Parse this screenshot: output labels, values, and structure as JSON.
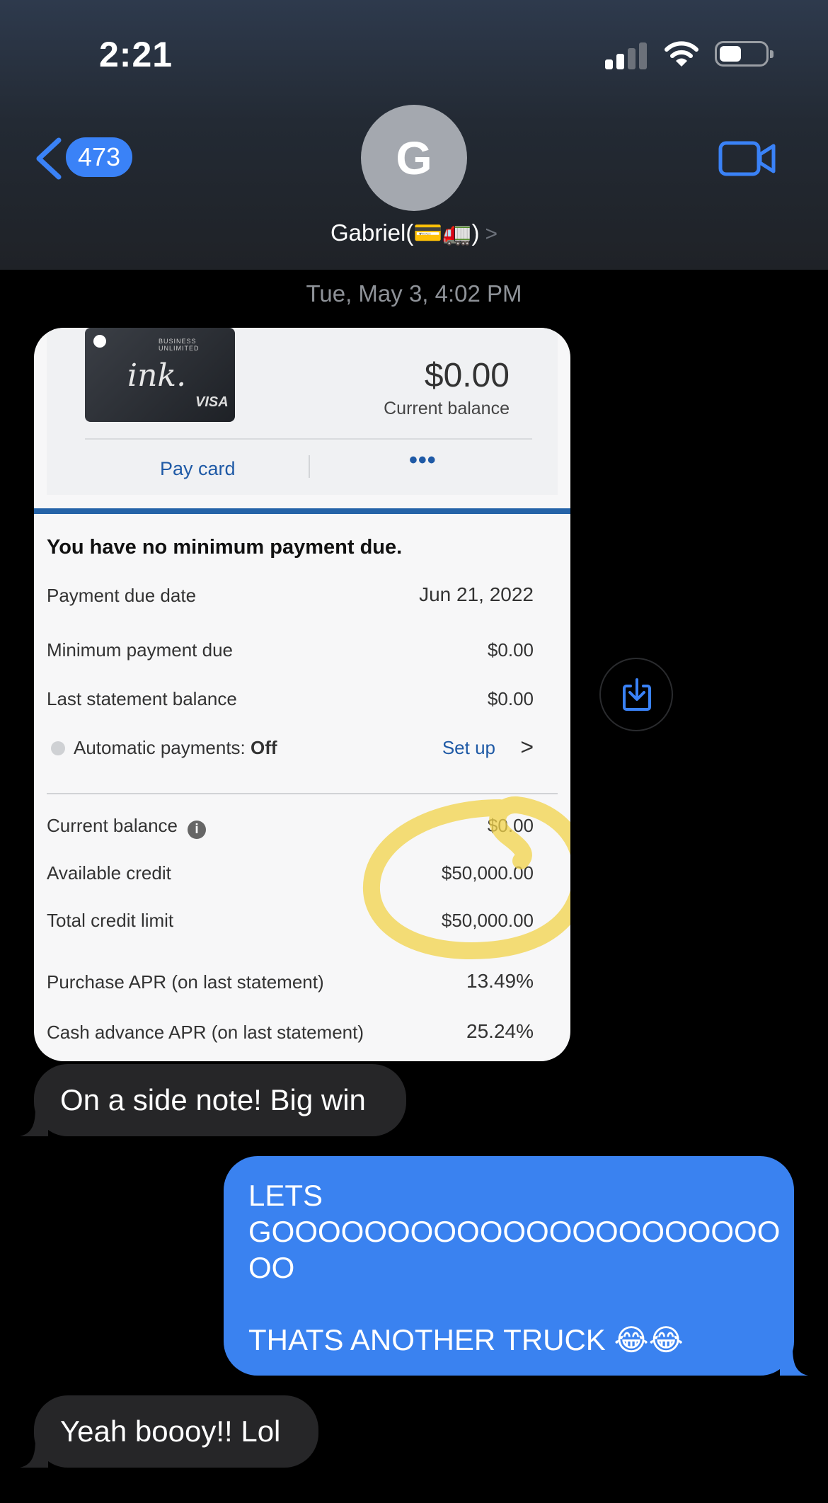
{
  "status_bar": {
    "time": "2:21"
  },
  "header": {
    "back_count": "473",
    "avatar_initial": "G",
    "contact_name": "Gabriel(💳🚛)",
    "contact_chevron": ">"
  },
  "thread": {
    "timestamp": "Tue, May 3, 4:02 PM",
    "screenshot": {
      "card_brand_small": "BUSINESS UNLIMITED",
      "card_script": "ink.",
      "card_network": "VISA",
      "balance_amount": "$0.00",
      "balance_label": "Current balance",
      "pay_card": "Pay card",
      "more": "•••",
      "heading": "You have no minimum payment due.",
      "rows": [
        {
          "label": "Payment due date",
          "value": "Jun 21, 2022"
        },
        {
          "label": "Minimum payment due",
          "value": "$0.00"
        },
        {
          "label": "Last statement balance",
          "value": "$0.00"
        }
      ],
      "auto_payments": {
        "label": "Automatic payments: ",
        "status": "Off",
        "action": "Set up",
        "chevron": ">"
      },
      "balances": [
        {
          "label": "Current balance",
          "value": "$0.00",
          "info_icon": "i"
        },
        {
          "label": "Available credit",
          "value": "$50,000.00"
        },
        {
          "label": "Total credit limit",
          "value": "$50,000.00"
        }
      ],
      "aprs": [
        {
          "label": "Purchase APR (on last statement)",
          "value": "13.49%"
        },
        {
          "label": "Cash advance APR (on last statement)",
          "value": "25.24%"
        }
      ],
      "highlight_color": "#f2d34a"
    },
    "messages": [
      {
        "from": "them",
        "text": "On a side note! Big win"
      },
      {
        "from": "me",
        "text": "LETS\nGOOOOOOOOOOOOOOOOOOOOOO\nOO\n\nTHATS ANOTHER TRUCK 😂😂"
      },
      {
        "from": "them",
        "text": "Yeah boooy!! Lol"
      }
    ]
  },
  "colors": {
    "accent": "#3a82f7",
    "received_bubble": "#262628",
    "sent_bubble": "#3a82f0",
    "chase_blue": "#1f5aa6"
  }
}
